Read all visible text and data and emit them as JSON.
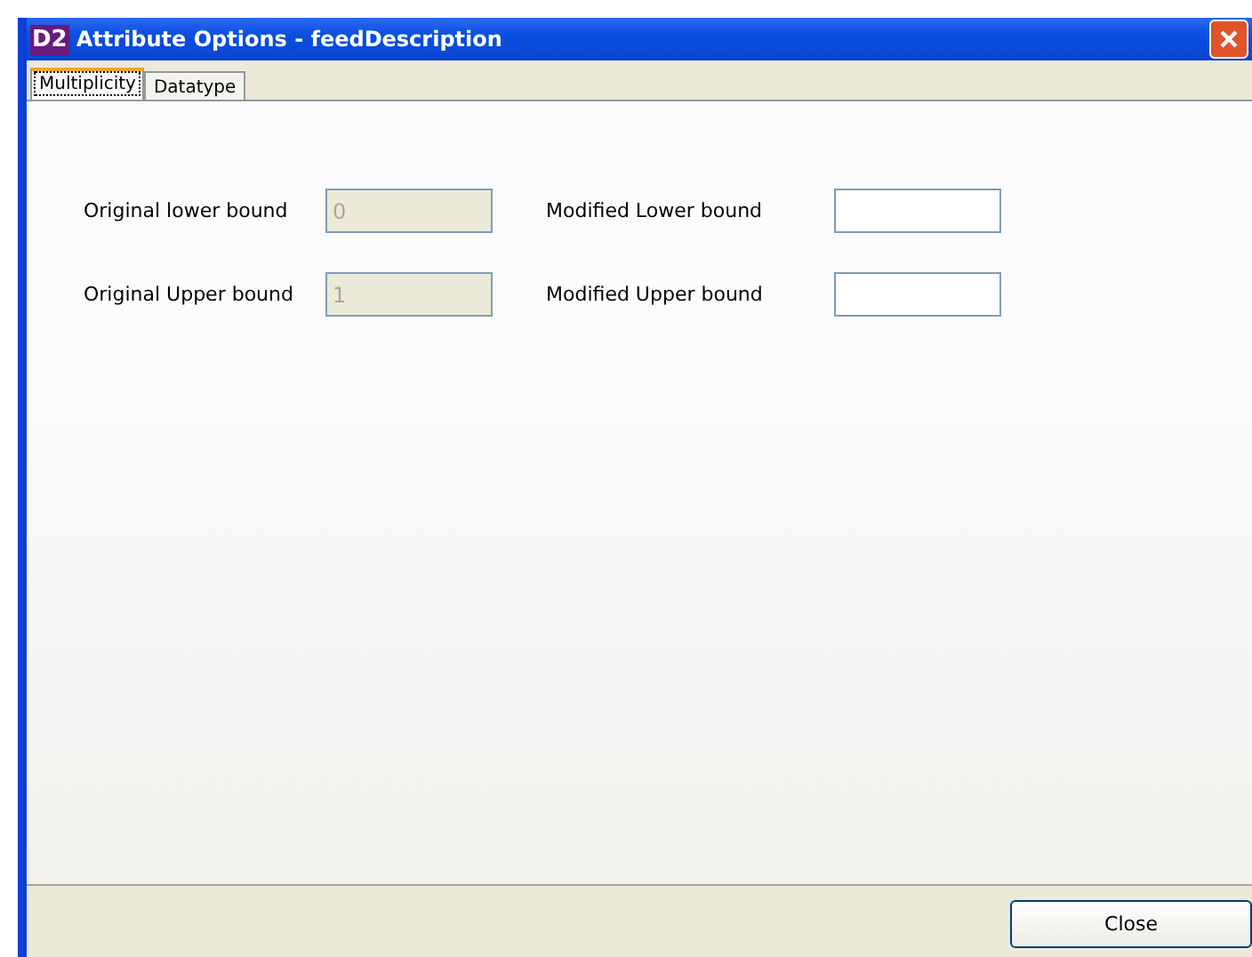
{
  "window": {
    "logo": "D2",
    "title": "Attribute Options - feedDescription"
  },
  "tabs": [
    {
      "label": "Multiplicity",
      "selected": true
    },
    {
      "label": "Datatype",
      "selected": false
    }
  ],
  "fields": [
    {
      "label": "Original lower bound",
      "value": "0",
      "disabled": true
    },
    {
      "label": "Modified Lower bound",
      "disabled": false
    },
    {
      "label": "Original Upper bound",
      "value": "1",
      "disabled": true
    },
    {
      "label": "Modified Upper bound",
      "disabled": false
    }
  ],
  "buttons": [
    {
      "label": "Close"
    }
  ]
}
